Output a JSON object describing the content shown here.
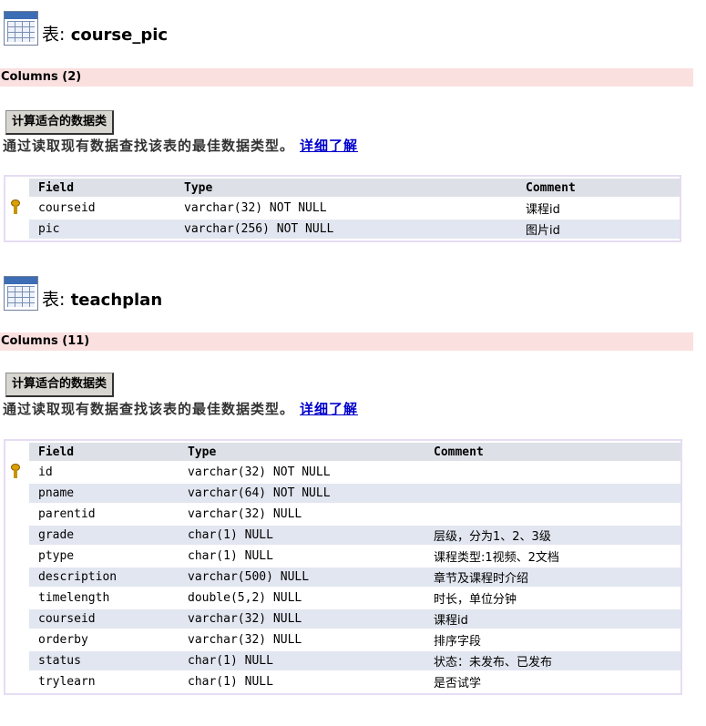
{
  "tables": [
    {
      "prefix": "表:",
      "name": "course_pic",
      "columns_label": "Columns (2)",
      "calc_button": "计算适合的数据类",
      "hint": "通过读取现有数据查找该表的最佳数据类型。",
      "hint_link": "详细了解",
      "headers": {
        "field": "Field",
        "type": "Type",
        "comment": "Comment"
      },
      "rows": [
        {
          "key": true,
          "field": "courseid",
          "type": "varchar(32) NOT NULL",
          "comment": "课程id"
        },
        {
          "key": false,
          "field": "pic",
          "type": "varchar(256) NOT NULL",
          "comment": "图片id"
        }
      ]
    },
    {
      "prefix": "表:",
      "name": "teachplan",
      "columns_label": "Columns (11)",
      "calc_button": "计算适合的数据类",
      "hint": "通过读取现有数据查找该表的最佳数据类型。",
      "hint_link": "详细了解",
      "headers": {
        "field": "Field",
        "type": "Type",
        "comment": "Comment"
      },
      "rows": [
        {
          "key": true,
          "field": "id",
          "type": "varchar(32) NOT NULL",
          "comment": ""
        },
        {
          "key": false,
          "field": "pname",
          "type": "varchar(64) NOT NULL",
          "comment": ""
        },
        {
          "key": false,
          "field": "parentid",
          "type": "varchar(32) NULL",
          "comment": ""
        },
        {
          "key": false,
          "field": "grade",
          "type": "char(1) NULL",
          "comment": "层级，分为1、2、3级"
        },
        {
          "key": false,
          "field": "ptype",
          "type": "char(1) NULL",
          "comment": "课程类型:1视频、2文档"
        },
        {
          "key": false,
          "field": "description",
          "type": "varchar(500) NULL",
          "comment": "章节及课程时介绍"
        },
        {
          "key": false,
          "field": "timelength",
          "type": "double(5,2) NULL",
          "comment": "时长，单位分钟"
        },
        {
          "key": false,
          "field": "courseid",
          "type": "varchar(32) NULL",
          "comment": "课程id"
        },
        {
          "key": false,
          "field": "orderby",
          "type": "varchar(32) NULL",
          "comment": "排序字段"
        },
        {
          "key": false,
          "field": "status",
          "type": "char(1) NULL",
          "comment": "状态：未发布、已发布"
        },
        {
          "key": false,
          "field": "trylearn",
          "type": "char(1) NULL",
          "comment": "是否试学"
        }
      ]
    }
  ]
}
